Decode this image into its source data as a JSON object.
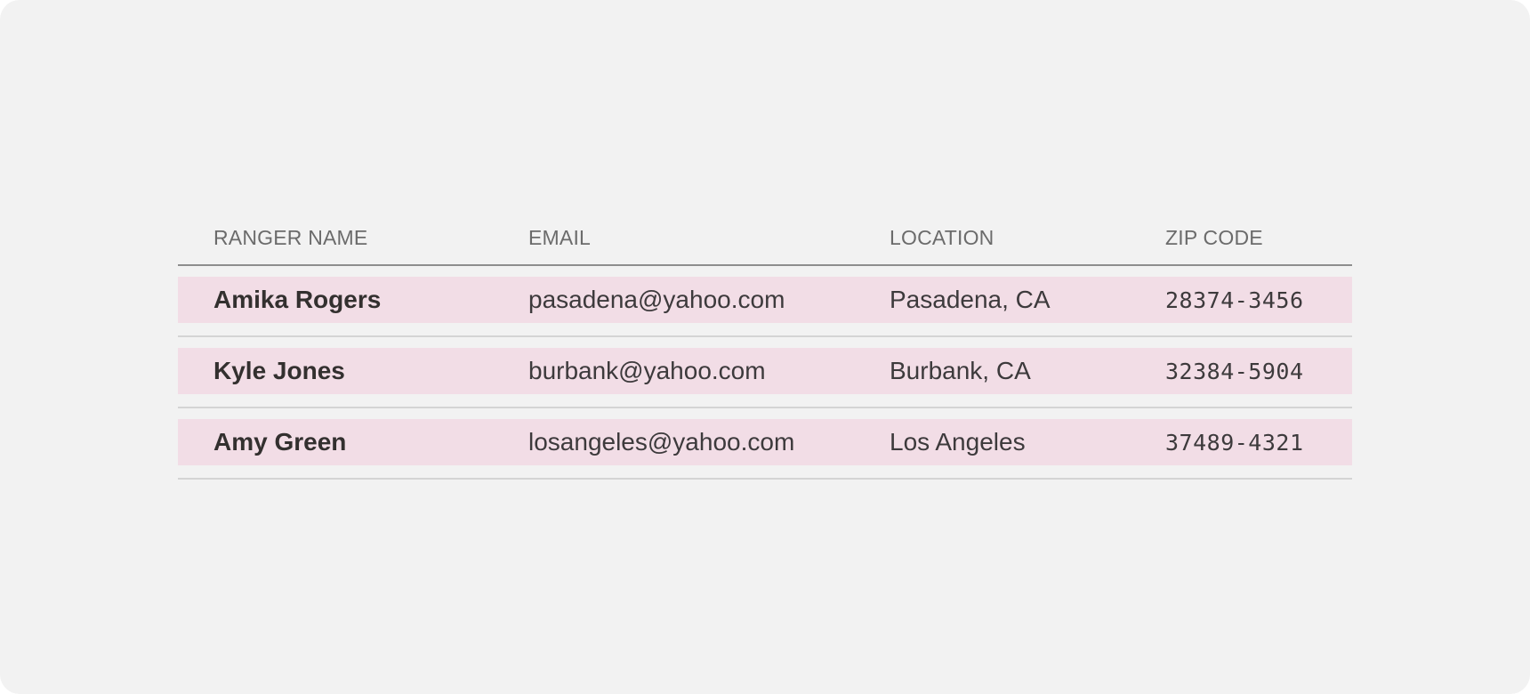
{
  "table": {
    "headers": [
      "RANGER NAME",
      "EMAIL",
      "LOCATION",
      "ZIP CODE"
    ],
    "rows": [
      {
        "name": "Amika Rogers",
        "email": "pasadena@yahoo.com",
        "location": "Pasadena, CA",
        "zip": "28374-3456"
      },
      {
        "name": "Kyle Jones",
        "email": "burbank@yahoo.com",
        "location": "Burbank, CA",
        "zip": "32384-5904"
      },
      {
        "name": "Amy Green",
        "email": "losangeles@yahoo.com",
        "location": "Los Angeles",
        "zip": "37489-4321"
      }
    ]
  },
  "colors": {
    "background": "#f2f2f2",
    "row_highlight": "#f2dde6",
    "header_text": "#6b6b6b",
    "body_text": "#3d3a3c"
  }
}
